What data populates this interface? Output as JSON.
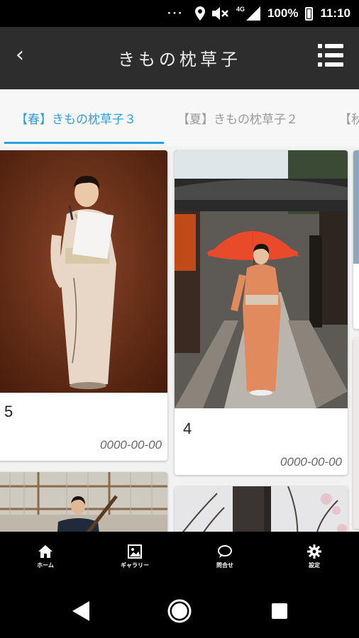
{
  "status_bar": {
    "dots": "···",
    "network": "4G",
    "battery": "100%",
    "time": "11:10"
  },
  "app_bar": {
    "back_glyph": "‹",
    "title": "きもの枕草子"
  },
  "tabs": [
    {
      "label": "【春】きもの枕草子３"
    },
    {
      "label": "【夏】きもの枕草子２"
    },
    {
      "label": "【秋"
    }
  ],
  "cards": [
    {
      "number": "5",
      "date": "0000-00-00"
    },
    {
      "number": "4",
      "date": "0000-00-00"
    }
  ],
  "bottom_nav": [
    {
      "label": "ホーム",
      "icon": "home-icon"
    },
    {
      "label": "ギャラリー",
      "icon": "gallery-icon"
    },
    {
      "label": "問合せ",
      "icon": "chat-bubble-icon"
    },
    {
      "label": "設定",
      "icon": "gear-icon"
    }
  ],
  "colors": {
    "accent": "#2c9fe0",
    "app_bar": "#2d2d2d",
    "umbrella": "#e84a2a"
  }
}
